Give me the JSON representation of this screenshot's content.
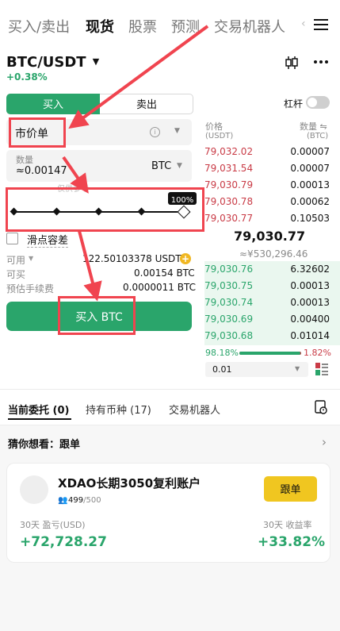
{
  "top_nav": {
    "tabs": [
      "买入/卖出",
      "现货",
      "股票",
      "预测",
      "交易机器人"
    ],
    "active_tab": "现货",
    "overflow": "‹"
  },
  "pair": {
    "symbol": "BTC/USDT",
    "change": "+0.38%"
  },
  "order_form": {
    "buy_label": "买入",
    "sell_label": "卖出",
    "leverage_label": "杠杆",
    "order_type": "市价单",
    "qty_label": "数量",
    "qty_value": "≈0.00147",
    "qty_unit": "BTC",
    "hint_text": "仅供参考",
    "slider_percent_label": "100%",
    "slider_fraction": 1.0,
    "slippage_label": "滑点容差",
    "available_label": "可用",
    "available_value": "122.50103378 USDT",
    "buyable_label": "可买",
    "buyable_value": "0.00154 BTC",
    "fee_label": "预估手续费",
    "fee_value": "0.0000011 BTC",
    "submit_label": "买入 BTC"
  },
  "order_book": {
    "price_header": "价格",
    "price_unit": "(USDT)",
    "qty_header": "数量 ⇋",
    "qty_unit": "(BTC)",
    "asks": [
      {
        "price": "79,032.02",
        "qty": "0.00007"
      },
      {
        "price": "79,031.54",
        "qty": "0.00007"
      },
      {
        "price": "79,030.79",
        "qty": "0.00013"
      },
      {
        "price": "79,030.78",
        "qty": "0.00062"
      },
      {
        "price": "79,030.77",
        "qty": "0.10503"
      }
    ],
    "last_price": "79,030.77",
    "last_price_fiat": "≈¥530,296.46",
    "bids": [
      {
        "price": "79,030.76",
        "qty": "6.32602"
      },
      {
        "price": "79,030.75",
        "qty": "0.00013"
      },
      {
        "price": "79,030.74",
        "qty": "0.00013"
      },
      {
        "price": "79,030.69",
        "qty": "0.00400"
      },
      {
        "price": "79,030.68",
        "qty": "0.01014"
      }
    ],
    "buy_ratio": "98.18%",
    "sell_ratio": "1.82%",
    "buy_fraction": 0.9818,
    "precision": "0.01"
  },
  "bottom_tabs": {
    "items": [
      "当前委托 (0)",
      "持有币种 (17)",
      "交易机器人"
    ],
    "active": 0
  },
  "suggest": {
    "title": "猜你想看：跟单",
    "card_name": "XDAO长期3050复利账户",
    "followers": "499",
    "followers_max": "/500",
    "follow_button": "跟单",
    "pnl_label": "30天 盈亏(USD)",
    "pnl_value": "+72,728.27",
    "roi_label": "30天 收益率",
    "roi_value": "+33.82%"
  },
  "colors": {
    "buy_green": "#2aa56b",
    "sell_red": "#c93b46",
    "annotation_red": "#f0444f",
    "follow_yellow": "#f0c620"
  }
}
